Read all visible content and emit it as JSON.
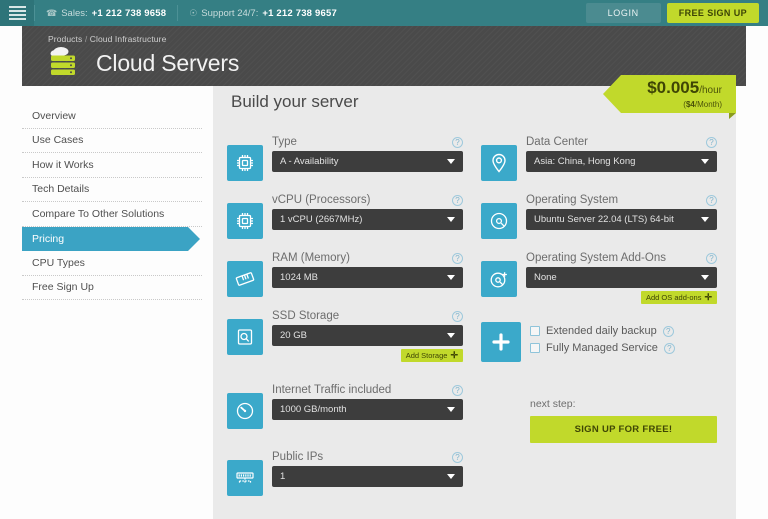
{
  "topbar": {
    "menu_icon": "hamburger-icon",
    "sales": {
      "icon": "phone-icon",
      "label": "Sales:",
      "number": "+1 212 738 9658"
    },
    "support": {
      "icon": "headset-icon",
      "label": "Support 24/7:",
      "number": "+1 212 738 9657"
    },
    "login_label": "LOGIN",
    "signup_label": "FREE SIGN UP"
  },
  "header": {
    "breadcrumb_root": "Products",
    "breadcrumb_sep": "/",
    "breadcrumb_current": "Cloud Infrastructure",
    "logo_icon": "cloud-server-icon",
    "title": "Cloud Servers"
  },
  "sidebar": {
    "items": [
      {
        "label": "Overview",
        "active": false
      },
      {
        "label": "Use Cases",
        "active": false
      },
      {
        "label": "How it Works",
        "active": false
      },
      {
        "label": "Tech Details",
        "active": false
      },
      {
        "label": "Compare To Other Solutions",
        "active": false
      },
      {
        "label": "Pricing",
        "active": true
      },
      {
        "label": "CPU Types",
        "active": false
      },
      {
        "label": "Free Sign Up",
        "active": false
      }
    ]
  },
  "main": {
    "title": "Build your server",
    "price": {
      "amount": "$0.005",
      "unit": "/hour",
      "monthly_amount": "$4",
      "monthly_unit": "/Month"
    },
    "help_glyph": "?",
    "left_fields": [
      {
        "icon": "cpu-chip-icon",
        "label": "Type",
        "value": "A - Availability"
      },
      {
        "icon": "cpu-chip-icon",
        "label": "vCPU (Processors)",
        "value": "1 vCPU (2667MHz)"
      },
      {
        "icon": "ram-stick-icon",
        "label": "RAM (Memory)",
        "value": "1024 MB"
      },
      {
        "icon": "ssd-disk-icon",
        "label": "SSD Storage",
        "value": "20 GB",
        "add_label": "Add Storage"
      },
      {
        "icon": "speedometer-icon",
        "label": "Internet Traffic included",
        "value": "1000 GB/month"
      },
      {
        "icon": "network-switch-icon",
        "label": "Public IPs",
        "value": "1"
      }
    ],
    "right_fields": [
      {
        "icon": "location-pin-icon",
        "label": "Data Center",
        "value": "Asia: China, Hong Kong"
      },
      {
        "icon": "disc-icon",
        "label": "Operating System",
        "value": "Ubuntu Server 22.04 (LTS) 64-bit"
      },
      {
        "icon": "disc-plus-icon",
        "label": "Operating System Add-Ons",
        "value": "None",
        "add_label": "Add OS add-ons"
      }
    ],
    "extras": {
      "icon": "plus-icon",
      "options": [
        {
          "label": "Extended daily backup",
          "checked": false
        },
        {
          "label": "Fully Managed Service",
          "checked": false
        }
      ]
    },
    "next_step_label": "next step:",
    "cta_label": "SIGN UP FOR FREE!"
  },
  "colors": {
    "teal_bar": "#357f84",
    "accent_green": "#c1d92b",
    "tile_blue": "#3ba9ca",
    "dropdown_dark": "#3d3d3d",
    "header_dark": "#4a4a4a",
    "panel_gray": "#eaeaea"
  }
}
